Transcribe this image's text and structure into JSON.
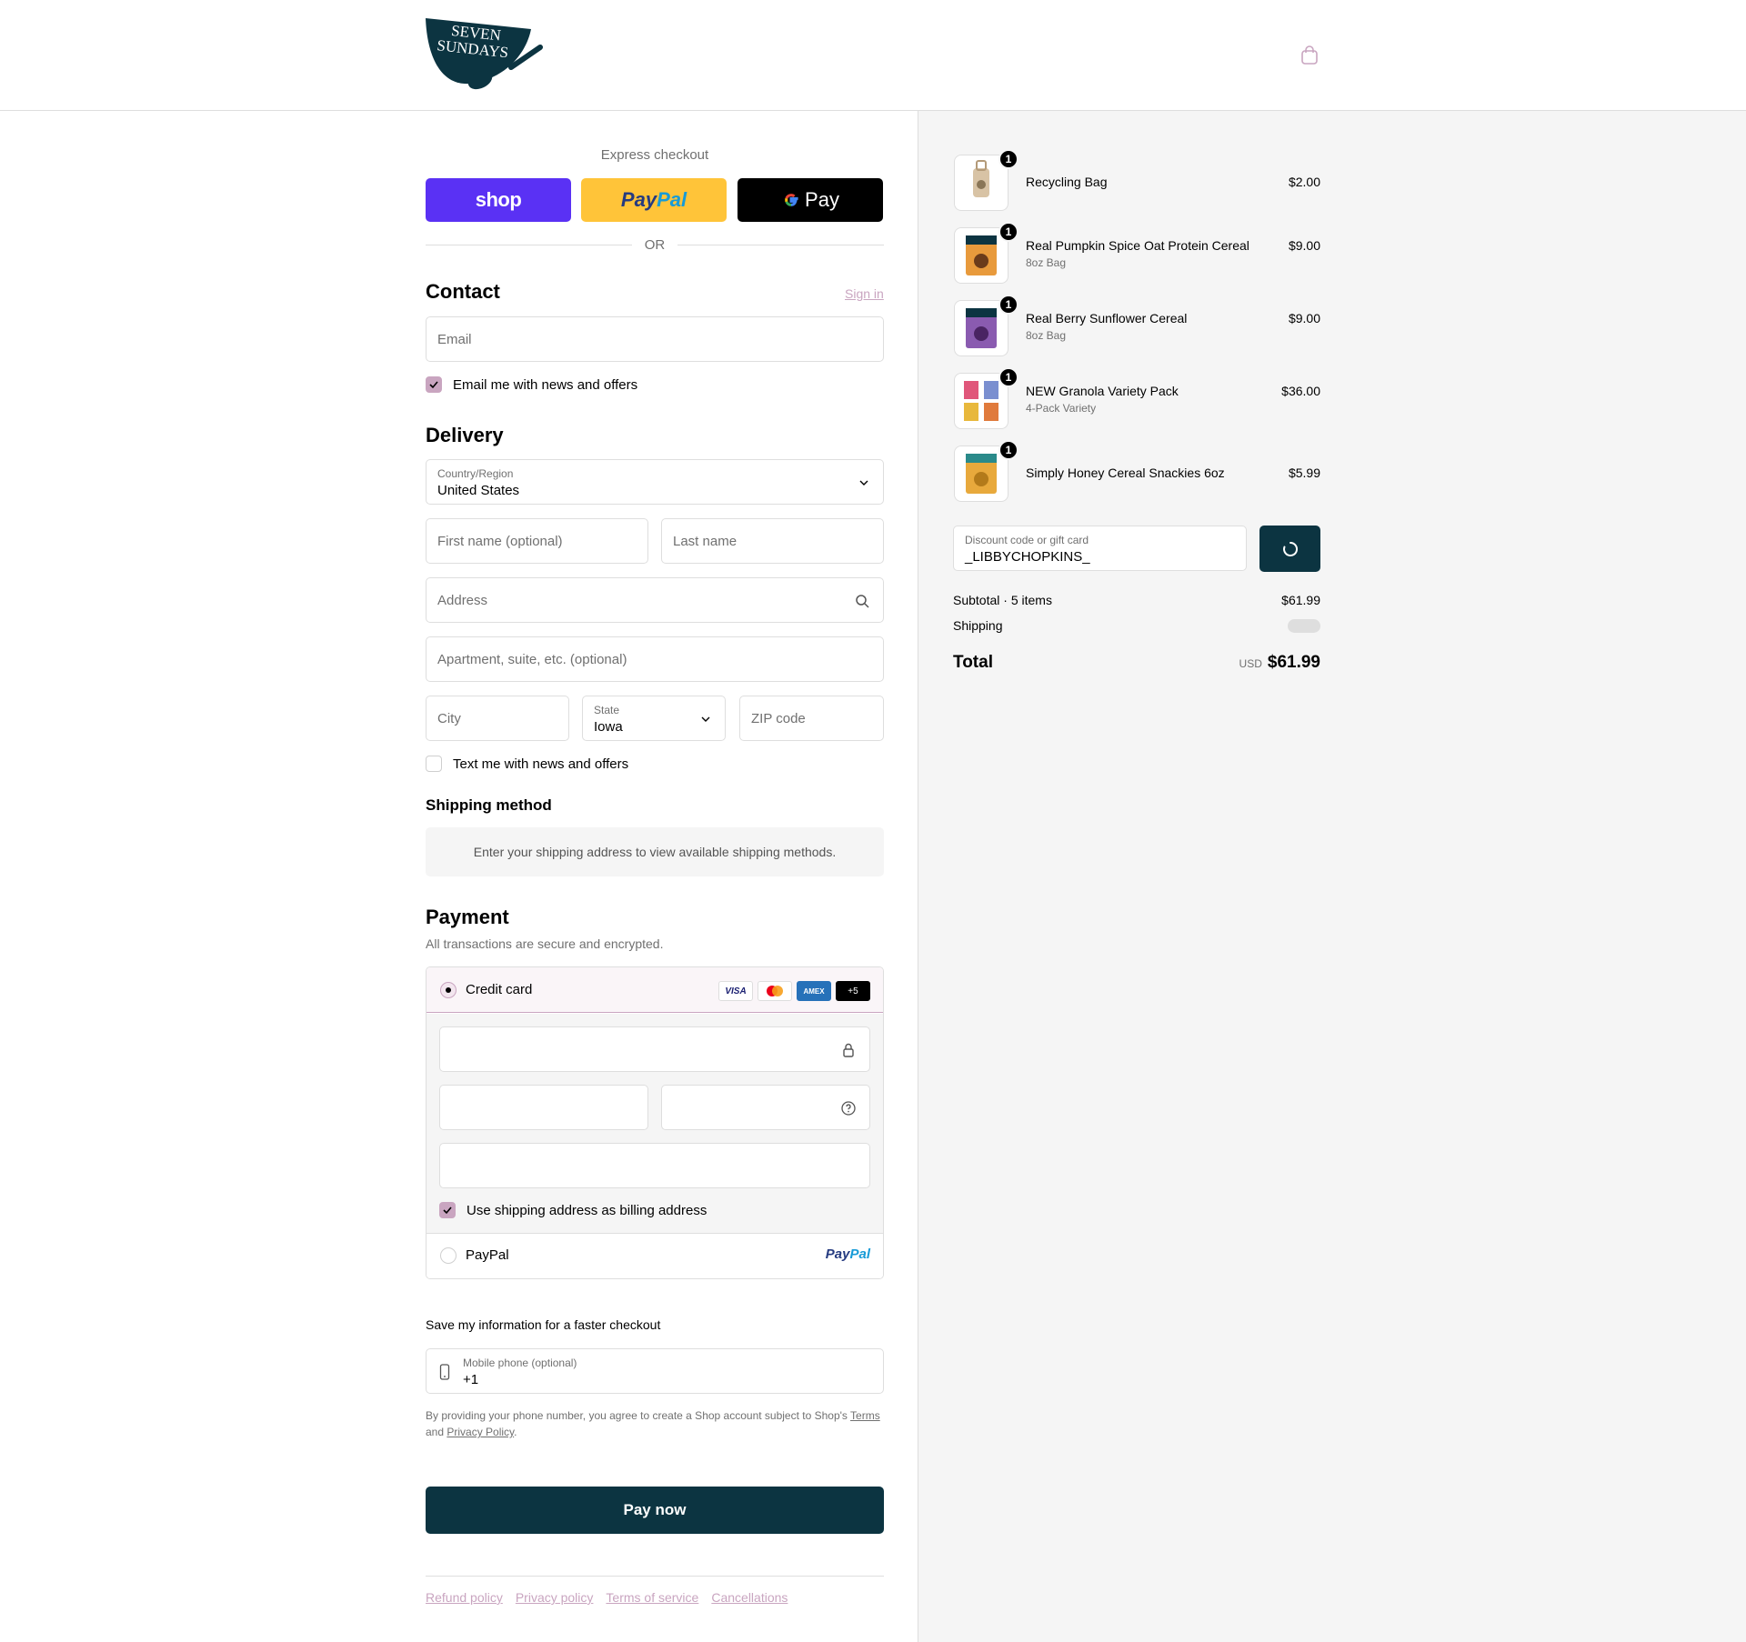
{
  "header": {
    "logo_text_line1": "SEVEN",
    "logo_text_line2": "SUNDAYS",
    "brand_color": "#0c3441"
  },
  "express": {
    "title": "Express checkout",
    "shop_label": "shop",
    "paypal_label_1": "Pay",
    "paypal_label_2": "Pal",
    "gpay_label": "Pay",
    "or_label": "OR"
  },
  "contact": {
    "heading": "Contact",
    "sign_in": "Sign in",
    "email_placeholder": "Email",
    "news_label": "Email me with news and offers",
    "news_checked": true
  },
  "delivery": {
    "heading": "Delivery",
    "country_label": "Country/Region",
    "country_value": "United States",
    "first_name_placeholder": "First name (optional)",
    "last_name_placeholder": "Last name",
    "address_placeholder": "Address",
    "apartment_placeholder": "Apartment, suite, etc. (optional)",
    "city_placeholder": "City",
    "state_label": "State",
    "state_value": "Iowa",
    "zip_placeholder": "ZIP code",
    "text_news_label": "Text me with news and offers",
    "text_news_checked": false
  },
  "shipping_method": {
    "heading": "Shipping method",
    "message": "Enter your shipping address to view available shipping methods."
  },
  "payment": {
    "heading": "Payment",
    "subtitle": "All transactions are secure and encrypted.",
    "credit_card_label": "Credit card",
    "card_brands": [
      "VISA",
      "",
      "AMEX",
      "+5"
    ],
    "billing_label": "Use shipping address as billing address",
    "billing_checked": true,
    "paypal_label": "PayPal",
    "paypal_logo_1": "Pay",
    "paypal_logo_2": "Pal"
  },
  "save_info": {
    "heading": "Save my information for a faster checkout",
    "phone_label": "Mobile phone (optional)",
    "phone_value": "+1",
    "disclaimer_1": "By providing your phone number, you agree to create a Shop account subject to Shop's ",
    "terms": "Terms",
    "disclaimer_2": "and ",
    "privacy": "Privacy Policy",
    "disclaimer_3": "."
  },
  "pay_now_label": "Pay now",
  "footer_links": [
    "Refund policy",
    "Privacy policy",
    "Terms of service",
    "Cancellations"
  ],
  "order": {
    "items": [
      {
        "name": "Recycling Bag",
        "variant": "",
        "price": "$2.00",
        "qty": "1"
      },
      {
        "name": "Real Pumpkin Spice Oat Protein Cereal",
        "variant": "8oz Bag",
        "price": "$9.00",
        "qty": "1"
      },
      {
        "name": "Real Berry Sunflower Cereal",
        "variant": "8oz Bag",
        "price": "$9.00",
        "qty": "1"
      },
      {
        "name": "NEW Granola Variety Pack",
        "variant": "4-Pack Variety",
        "price": "$36.00",
        "qty": "1"
      },
      {
        "name": "Simply Honey Cereal Snackies 6oz",
        "variant": "",
        "price": "$5.99",
        "qty": "1"
      }
    ],
    "discount_label": "Discount code or gift card",
    "discount_value": "_LIBBYCHOPKINS_",
    "subtotal_label": "Subtotal · 5 items",
    "subtotal_value": "$61.99",
    "shipping_label": "Shipping",
    "total_label": "Total",
    "currency": "USD",
    "total_value": "$61.99"
  }
}
